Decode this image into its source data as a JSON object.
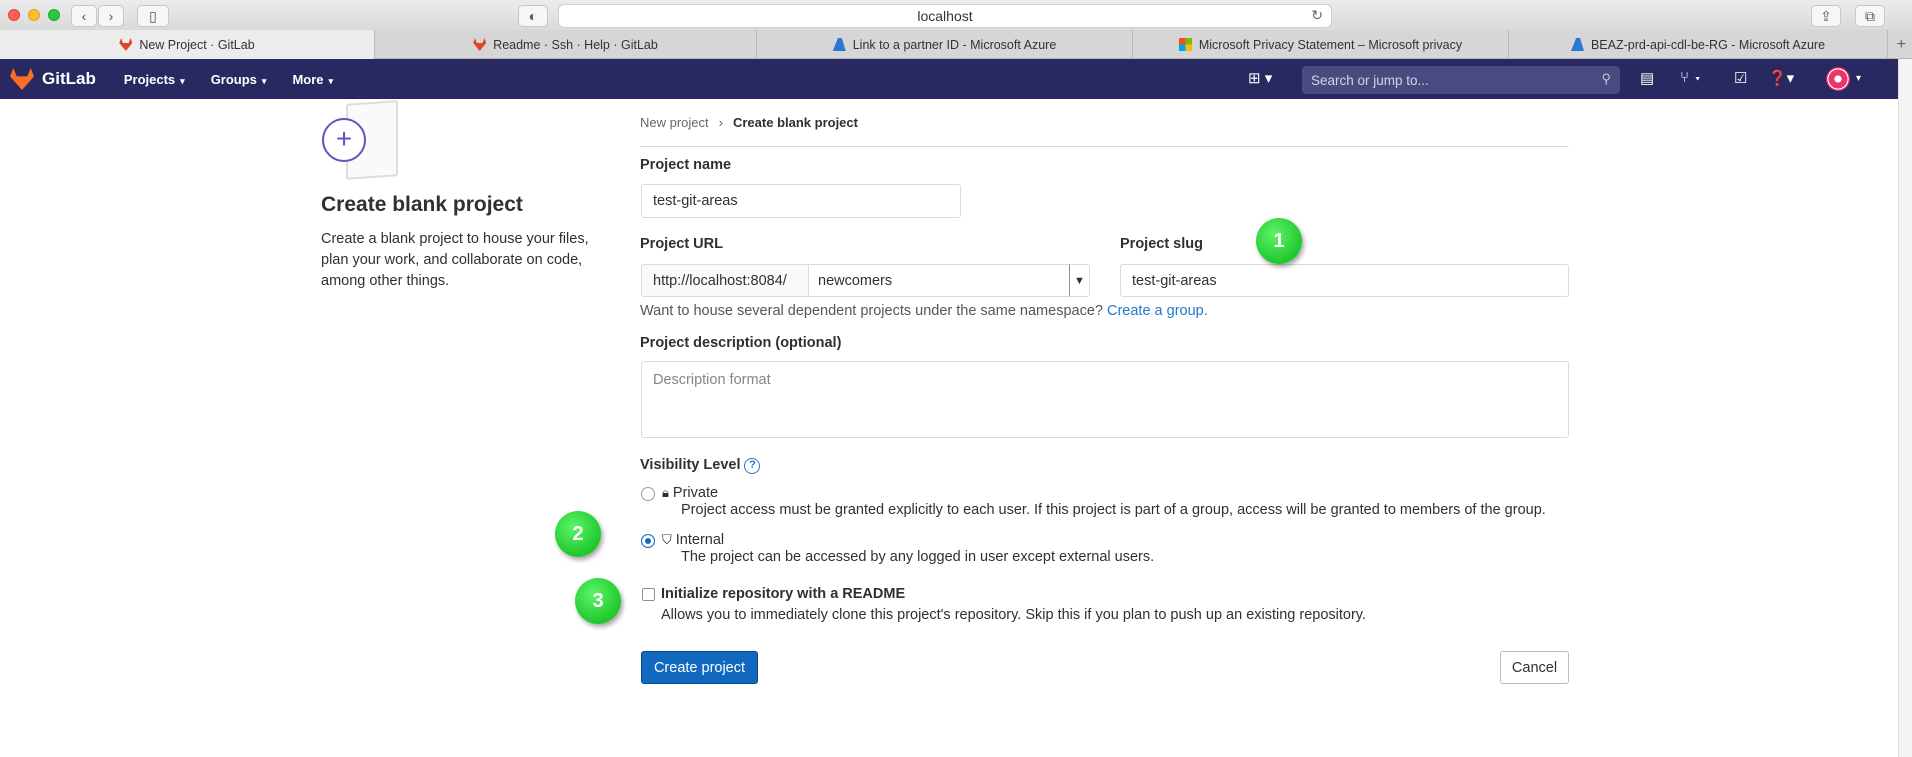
{
  "browser": {
    "url": "localhost",
    "tabs": [
      {
        "label": "New Project · GitLab",
        "icon": "gitlab-icon",
        "active": true
      },
      {
        "label": "Readme · Ssh · Help · GitLab",
        "icon": "gitlab-icon",
        "active": false
      },
      {
        "label": "Link to a partner ID - Microsoft Azure",
        "icon": "azure-icon",
        "active": false
      },
      {
        "label": "Microsoft Privacy Statement – Microsoft privacy",
        "icon": "microsoft-icon",
        "active": false
      },
      {
        "label": "BEAZ-prd-api-cdl-be-RG - Microsoft Azure",
        "icon": "azure-icon",
        "active": false
      }
    ]
  },
  "gitlab_nav": {
    "brand": "GitLab",
    "menu": [
      "Projects",
      "Groups",
      "More"
    ],
    "search_placeholder": "Search or jump to..."
  },
  "left": {
    "title": "Create blank project",
    "description": "Create a blank project to house your files, plan your work, and collaborate on code, among other things."
  },
  "breadcrumb": [
    "New project",
    "Create blank project"
  ],
  "form": {
    "project_name_label": "Project name",
    "project_name_value": "test-git-areas",
    "project_url_label": "Project URL",
    "url_prefix": "http://localhost:8084/",
    "namespace": "newcomers",
    "project_slug_label": "Project slug",
    "project_slug_value": "test-git-areas",
    "namespace_help": "Want to house several dependent projects under the same namespace?",
    "create_group_link": "Create a group.",
    "description_label": "Project description (optional)",
    "description_placeholder": "Description format",
    "visibility_label": "Visibility Level",
    "visibility_options": [
      {
        "title": "Private",
        "desc": "Project access must be granted explicitly to each user. If this project is part of a group, access will be granted to members of the group.",
        "checked": false
      },
      {
        "title": "Internal",
        "desc": "The project can be accessed by any logged in user except external users.",
        "checked": true
      }
    ],
    "readme_label": "Initialize repository with a README",
    "readme_desc": "Allows you to immediately clone this project's repository. Skip this if you plan to push up an existing repository.",
    "readme_checked": false,
    "create_button": "Create project",
    "cancel_button": "Cancel"
  },
  "markers": [
    "1",
    "2",
    "3"
  ],
  "colors": {
    "nav": "#292961",
    "primary": "#1068bf",
    "link": "#1f78d1",
    "marker": "#21c72c"
  }
}
